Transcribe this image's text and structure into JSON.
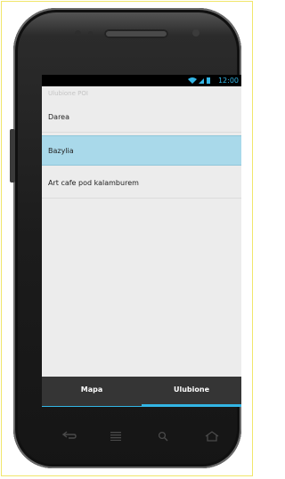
{
  "status_bar": {
    "time": "12:00",
    "accent": "#33b5e5"
  },
  "list": {
    "header": "Ulubione POI",
    "items": [
      {
        "label": "Darea",
        "selected": false
      },
      {
        "label": "Bazylia",
        "selected": true
      },
      {
        "label": "Art cafe pod kalamburem",
        "selected": false
      }
    ]
  },
  "tabs": [
    {
      "label": "Mapa",
      "active": false
    },
    {
      "label": "Ulubione",
      "active": true
    }
  ],
  "nav_icons": [
    "back-icon",
    "menu-icon",
    "search-icon",
    "home-icon"
  ]
}
